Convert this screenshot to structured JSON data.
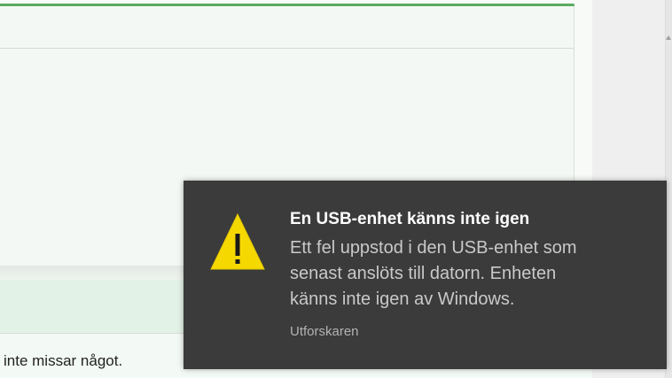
{
  "background_page": {
    "body_text": "inte missar något.",
    "colors": {
      "accent": "#5cab5f",
      "band": "#e3f2e6"
    }
  },
  "notification": {
    "icon": "warning-icon",
    "title": "En USB-enhet känns inte igen",
    "message_lines": [
      "Ett fel uppstod i den USB-enhet som",
      "senast anslöts till datorn. Enheten",
      "känns inte igen av Windows."
    ],
    "source": "Utforskaren",
    "colors": {
      "background": "#3a3b3a",
      "title": "#ffffff",
      "message": "#c9c9c9",
      "icon_fill": "#f5d800"
    }
  }
}
